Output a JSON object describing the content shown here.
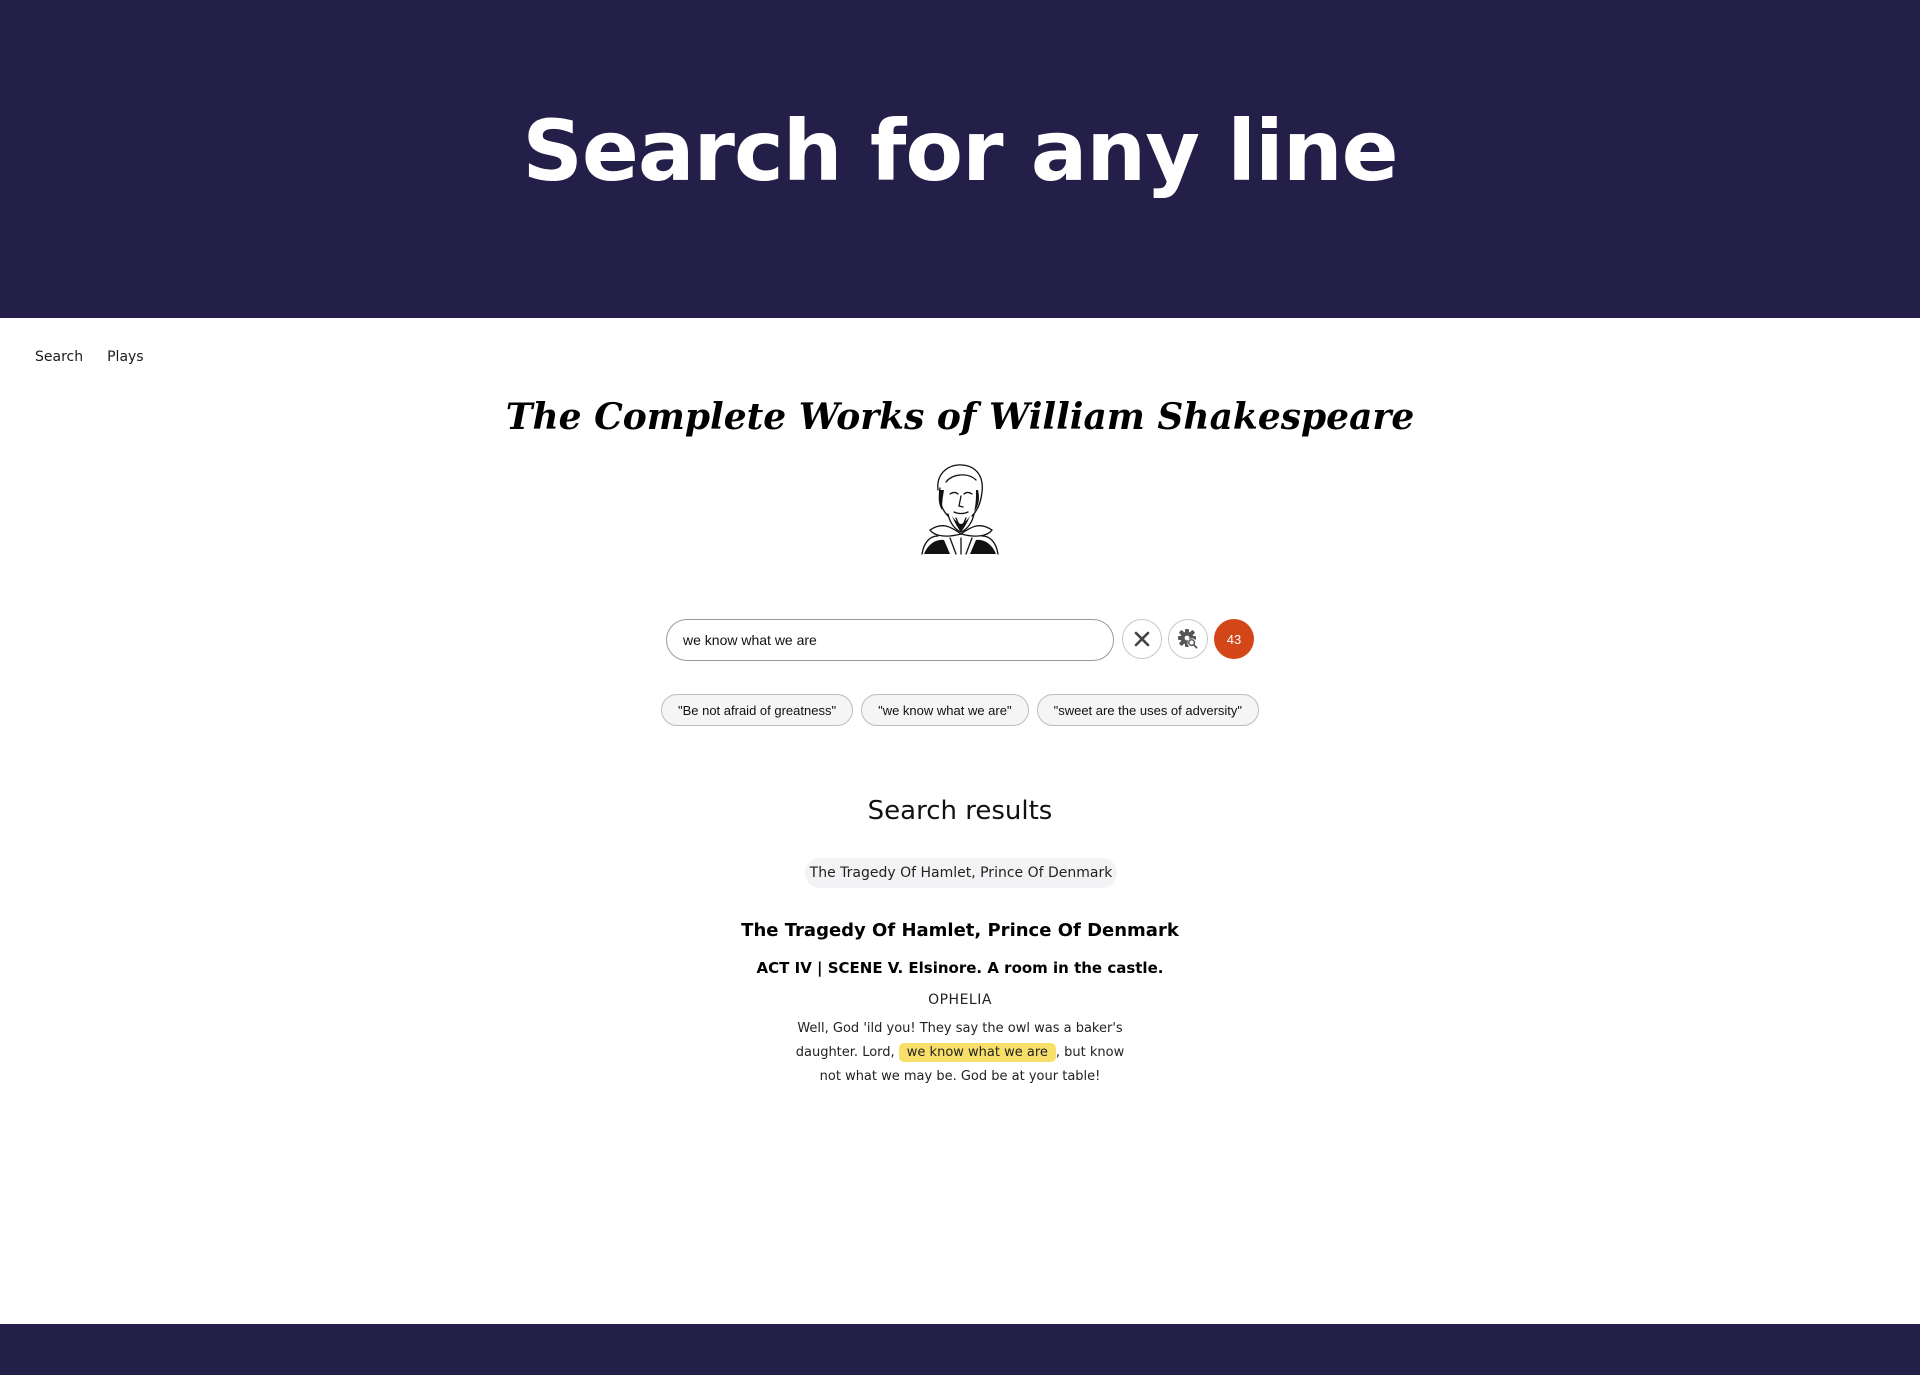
{
  "hero": {
    "title": "Search for any line"
  },
  "nav": {
    "items": [
      {
        "label": "Search"
      },
      {
        "label": "Plays"
      }
    ]
  },
  "site_title": "The Complete Works of William Shakespeare",
  "search": {
    "value": "we know what we are",
    "placeholder": "",
    "result_count": "43"
  },
  "suggestions": [
    {
      "label": "\"Be not afraid of greatness\""
    },
    {
      "label": "\"we know what we are\""
    },
    {
      "label": "\"sweet are the uses of adversity\""
    }
  ],
  "results": {
    "heading": "Search results",
    "filter_chip": "The Tragedy Of Hamlet, Prince Of Denmark",
    "items": [
      {
        "play": "The Tragedy Of Hamlet, Prince Of Denmark",
        "scene": "ACT IV | SCENE V. Elsinore. A room in the castle.",
        "speaker": "OPHELIA",
        "text_before": "Well, God 'ild you! They say the owl was a baker's daughter. Lord, ",
        "highlight": "we know what we are",
        "text_after": ", but know not what we may be. God be at your table!"
      }
    ]
  },
  "colors": {
    "header_bg": "#241f48",
    "footer_bg": "#241f48",
    "badge_bg": "#d24617",
    "highlight_bg": "#f7df6a"
  },
  "icons": {
    "clear": "close-icon",
    "settings": "gear-search-icon",
    "portrait": "shakespeare-portrait"
  }
}
